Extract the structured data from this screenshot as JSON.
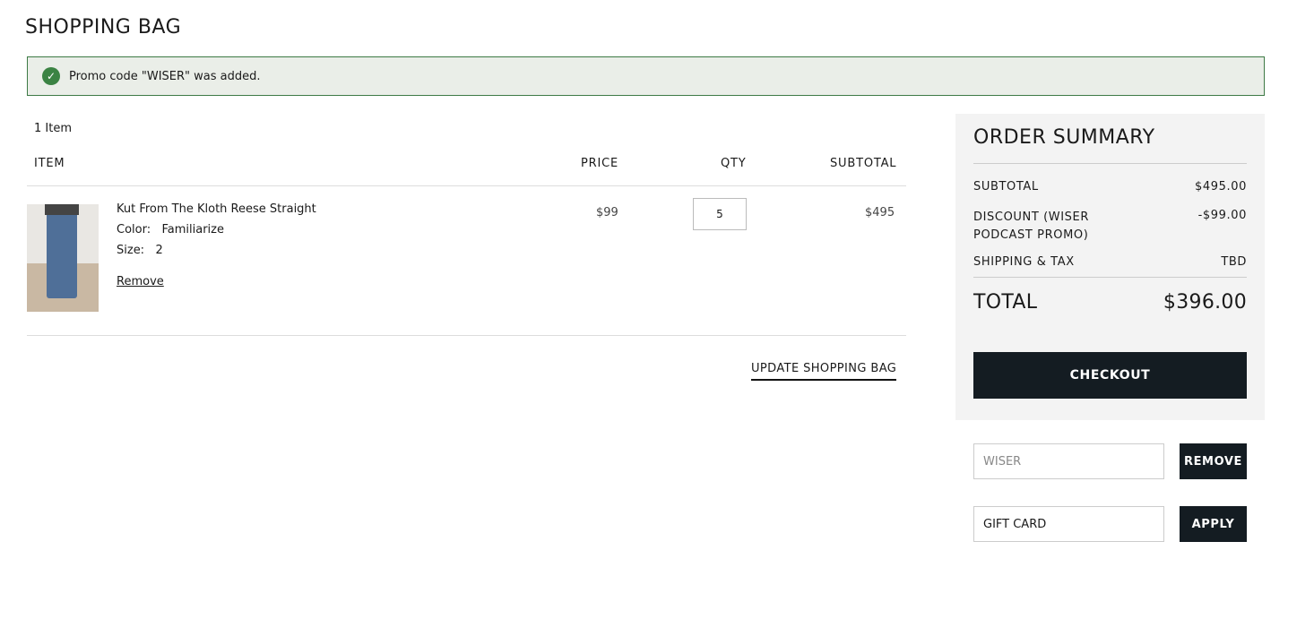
{
  "page_title": "SHOPPING BAG",
  "alert": {
    "icon": "check-circle-icon",
    "message": "Promo code \"WISER\" was added.",
    "color": "#3b8343"
  },
  "cart": {
    "item_count": "1 Item",
    "columns": {
      "item": "ITEM",
      "price": "PRICE",
      "qty": "QTY",
      "subtotal": "SUBTOTAL"
    },
    "items": [
      {
        "name": "Kut From The Kloth Reese Straight",
        "color_label": "Color:",
        "color": "Familiarize",
        "size_label": "Size:",
        "size": "2",
        "remove": "Remove",
        "price": "$99",
        "qty": "5",
        "subtotal": "$495"
      }
    ],
    "update_label": "UPDATE SHOPPING BAG"
  },
  "summary": {
    "title": "ORDER SUMMARY",
    "subtotal_label": "SUBTOTAL",
    "subtotal": "$495.00",
    "discount_label": "DISCOUNT (WISER PODCAST PROMO)",
    "discount": "-$99.00",
    "shipping_label": "SHIPPING & TAX",
    "shipping": "TBD",
    "total_label": "TOTAL",
    "total": "$396.00",
    "checkout": "CHECKOUT"
  },
  "promo": {
    "value": "WISER",
    "button": "REMOVE"
  },
  "gift": {
    "placeholder": "GIFT CARD",
    "button": "APPLY"
  }
}
